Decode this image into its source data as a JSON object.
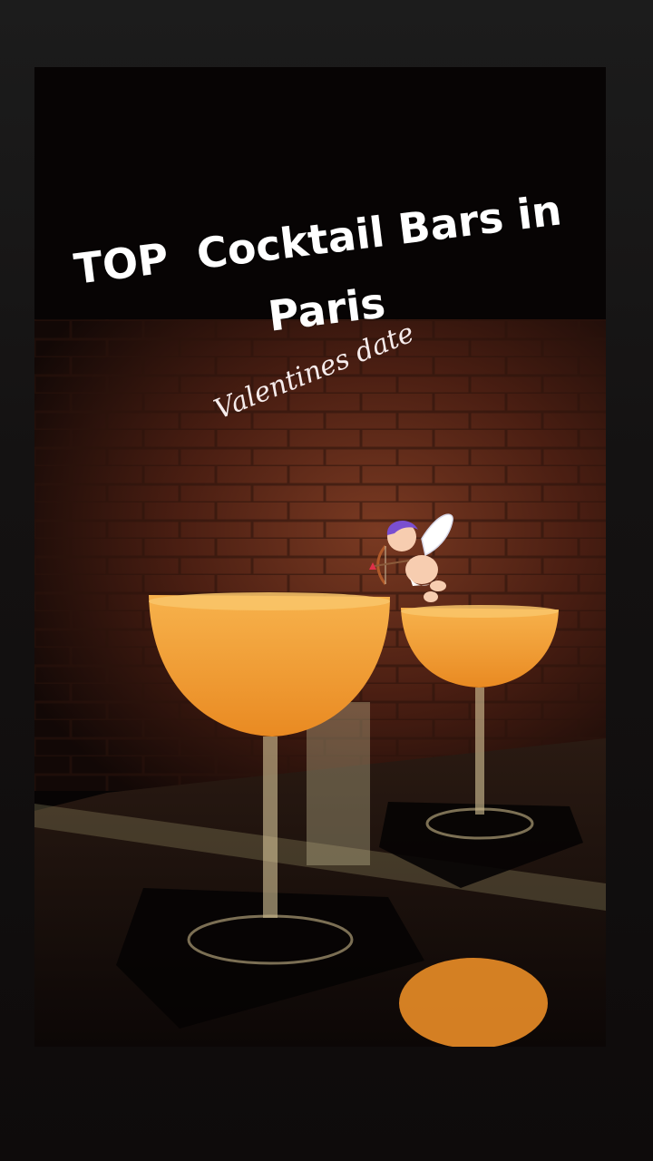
{
  "story": {
    "title_line1": "TOP  Cocktail Bars in",
    "title_line2": "Paris",
    "subtitle": "Valentines date"
  },
  "stickers": [
    "cupid-icon"
  ],
  "colors": {
    "cocktail": "#f4a23a",
    "brick": "#6b2e1c",
    "background": "#1a1818",
    "text": "#ffffff"
  }
}
